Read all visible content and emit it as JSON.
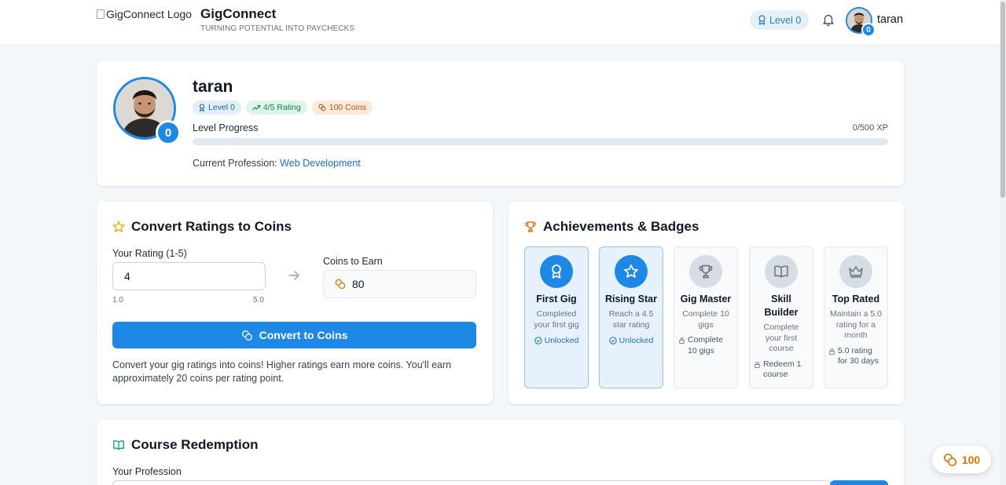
{
  "header": {
    "logo_alt": "GigConnect Logo",
    "brand": "GigConnect",
    "tagline": "TURNING POTENTIAL INTO PAYCHECKS",
    "level": "Level 0",
    "username": "taran",
    "avatar_badge": "0"
  },
  "profile": {
    "name": "taran",
    "level_badge": "0",
    "chips": {
      "level": "Level 0",
      "rating": "4/5 Rating",
      "coins": "100 Coins"
    },
    "progress_label": "Level Progress",
    "xp_text": "0/500 XP",
    "xp_fraction": 0,
    "profession_label": "Current Profession:",
    "profession_value": "Web Development"
  },
  "convert": {
    "title": "Convert Ratings to Coins",
    "rating_label": "Your Rating (1-5)",
    "rating_value": "4",
    "range_min": "1.0",
    "range_max": "5.0",
    "coins_label": "Coins to Earn",
    "coins_value": "80",
    "button_label": "Convert to Coins",
    "description": "Convert your gig ratings into coins! Higher ratings earn more coins. You'll earn approximately 20 coins per rating point."
  },
  "achievements": {
    "title": "Achievements & Badges",
    "badges": [
      {
        "title": "First Gig",
        "desc": "Completed your first gig",
        "status": "Unlocked",
        "icon": "award-icon"
      },
      {
        "title": "Rising Star",
        "desc": "Reach a 4.5 star rating",
        "status": "Unlocked",
        "icon": "star-icon"
      },
      {
        "title": "Gig Master",
        "desc": "Complete 10 gigs",
        "requirement": "Complete 10 gigs",
        "icon": "trophy-icon"
      },
      {
        "title": "Skill Builder",
        "desc": "Complete your first course",
        "requirement": "Redeem 1 course",
        "icon": "book-icon"
      },
      {
        "title": "Top Rated",
        "desc": "Maintain a 5.0 rating for a month",
        "requirement": "5.0 rating for 30 days",
        "icon": "crown-icon"
      }
    ]
  },
  "course": {
    "title": "Course Redemption",
    "profession_label": "Your Profession"
  },
  "floating": {
    "coins": "100"
  },
  "colors": {
    "accent": "#1e88e5",
    "coin": "#d97706"
  }
}
